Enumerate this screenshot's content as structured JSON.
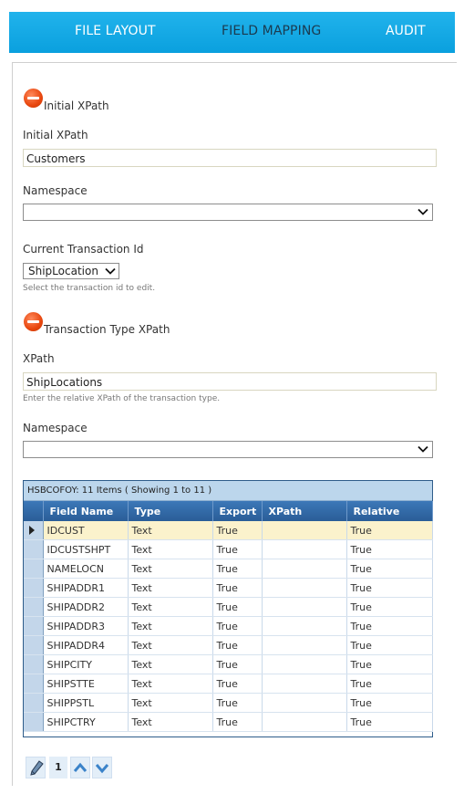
{
  "tabs": [
    {
      "label": "FILE LAYOUT"
    },
    {
      "label": "FIELD MAPPING"
    },
    {
      "label": "AUDIT"
    }
  ],
  "initial_section": {
    "heading": "Initial XPath",
    "xpath_label": "Initial XPath",
    "xpath_value": "Customers",
    "namespace_label": "Namespace",
    "namespace_value": ""
  },
  "transaction": {
    "label": "Current Transaction Id",
    "selected": "ShipLocation",
    "hint": "Select the transaction id to edit."
  },
  "transaction_section": {
    "heading": "Transaction Type XPath",
    "xpath_label": "XPath",
    "xpath_value": "ShipLocations",
    "xpath_hint": "Enter the relative XPath of the transaction type.",
    "namespace_label": "Namespace",
    "namespace_value": ""
  },
  "grid": {
    "title": "HSBCOFOY: 11 Items ( Showing 1 to 11 )",
    "columns": [
      "Field Name",
      "Type",
      "Export",
      "XPath",
      "Relative"
    ],
    "rows": [
      [
        "IDCUST",
        "Text",
        "True",
        "",
        "True"
      ],
      [
        "IDCUSTSHPT",
        "Text",
        "True",
        "",
        "True"
      ],
      [
        "NAMELOCN",
        "Text",
        "True",
        "",
        "True"
      ],
      [
        "SHIPADDR1",
        "Text",
        "True",
        "",
        "True"
      ],
      [
        "SHIPADDR2",
        "Text",
        "True",
        "",
        "True"
      ],
      [
        "SHIPADDR3",
        "Text",
        "True",
        "",
        "True"
      ],
      [
        "SHIPADDR4",
        "Text",
        "True",
        "",
        "True"
      ],
      [
        "SHIPCITY",
        "Text",
        "True",
        "",
        "True"
      ],
      [
        "SHIPSTTE",
        "Text",
        "True",
        "",
        "True"
      ],
      [
        "SHIPPSTL",
        "Text",
        "True",
        "",
        "True"
      ],
      [
        "SHIPCTRY",
        "Text",
        "True",
        "",
        "True"
      ]
    ],
    "active_row": 0
  },
  "pager": {
    "page": "1"
  },
  "colors": {
    "tab_bar": "#0aa0de",
    "active_tab_text": "#1b3a4f",
    "grid_header": "#2a5d97",
    "active_row": "#fbf2cc"
  }
}
